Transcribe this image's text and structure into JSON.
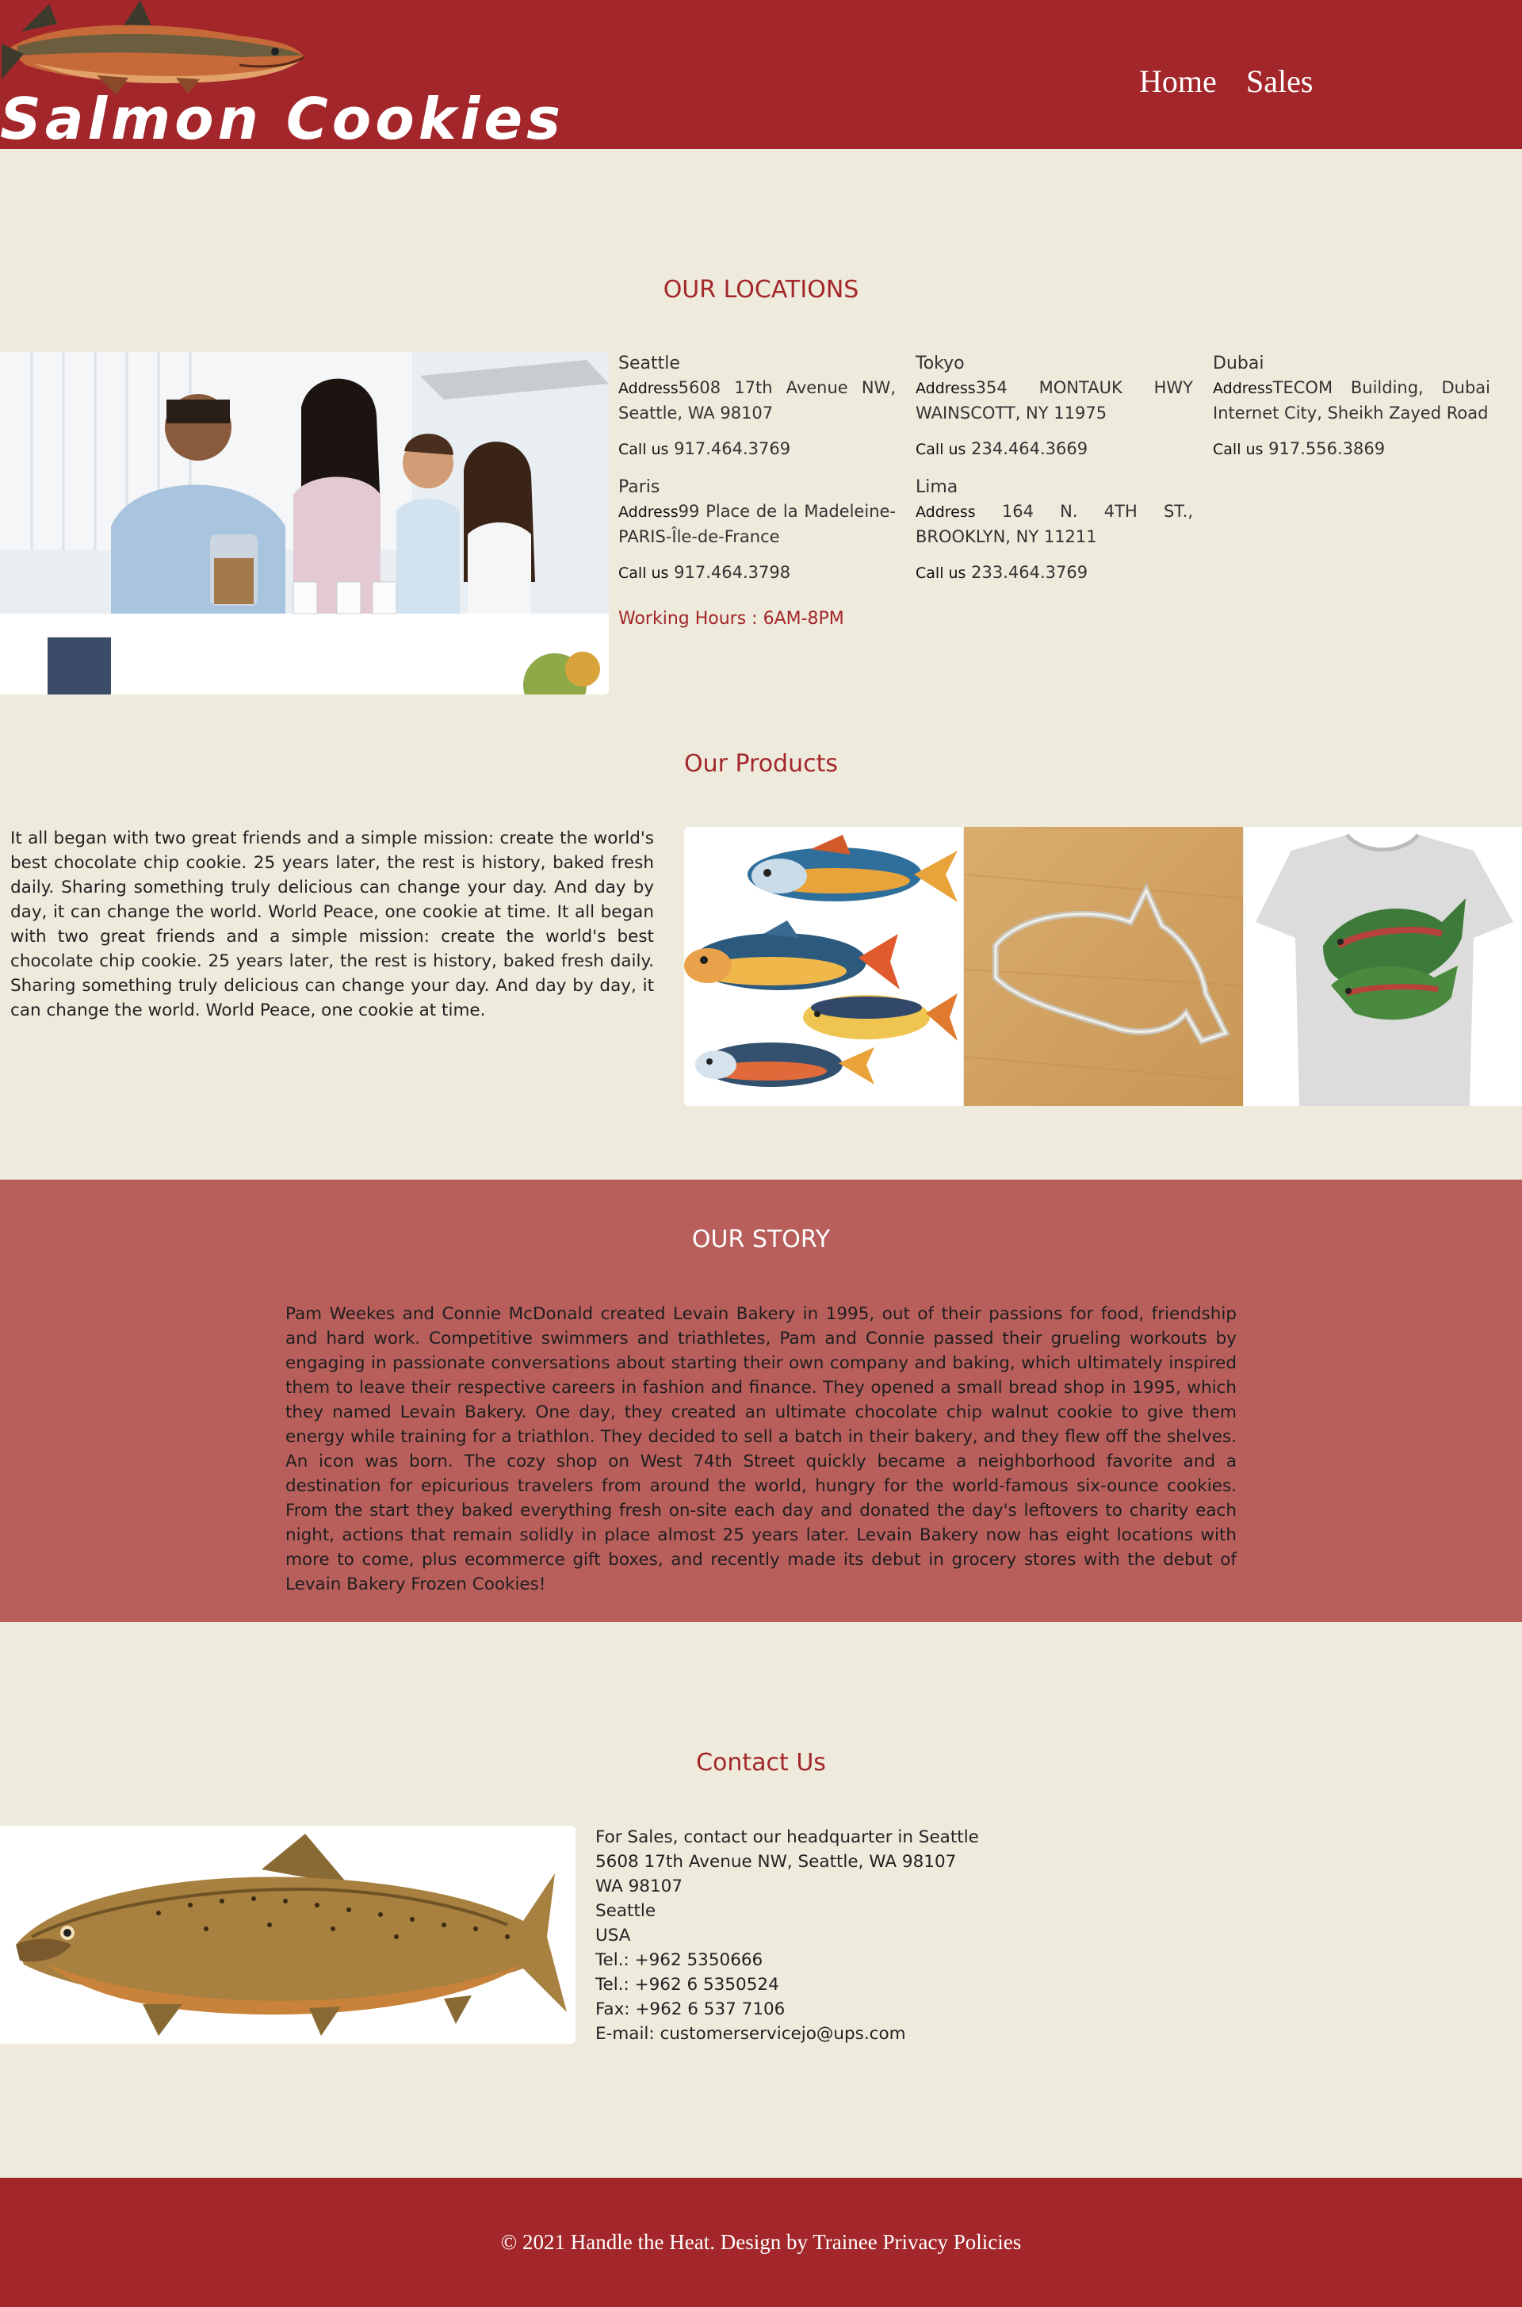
{
  "header": {
    "brand": "Salmon Cookies",
    "nav": [
      "Home",
      "Sales"
    ],
    "logo_icon": "salmon-fish-logo"
  },
  "locations": {
    "title": "OUR LOCATIONS",
    "address_label": "Address",
    "call_label": "Call us",
    "items": [
      {
        "city": "Seattle",
        "address": "5608 17th Avenue NW, Seattle, WA 98107",
        "phone": "917.464.3769"
      },
      {
        "city": "Tokyo",
        "address": "354 MONTAUK HWY WAINSCOTT, NY 11975",
        "phone": "234.464.3669"
      },
      {
        "city": "Dubai",
        "address": "TECOM Building, Dubai Internet City, Sheikh Zayed Road",
        "phone": "917.556.3869"
      },
      {
        "city": "Paris",
        "address": "99 Place de la Madeleine-PARIS-Île-de-France",
        "phone": "917.464.3798"
      },
      {
        "city": "Lima",
        "address": " 164 N. 4TH ST., BROOKLYN, NY 11211",
        "phone": "233.464.3769"
      }
    ],
    "hours": "Working Hours : 6AM-8PM"
  },
  "products": {
    "title": "Our Products",
    "text": "It all began with two great friends and a simple mission: create the world's best chocolate chip cookie. 25 years later, the rest is history, baked fresh daily. Sharing something truly delicious can change your day. And day by day, it can change the world. World Peace, one cookie at time. It all began with two great friends and a simple mission: create the world's best chocolate chip cookie. 25 years later, the rest is history, baked fresh daily. Sharing something truly delicious can change your day. And day by day, it can change the world. World Peace, one cookie at time."
  },
  "story": {
    "title": "OUR STORY",
    "text": "Pam Weekes and Connie McDonald created Levain Bakery in 1995, out of their passions for food, friendship and hard work. Competitive swimmers and triathletes, Pam and Connie passed their grueling workouts by engaging in passionate conversations about starting their own company and baking, which ultimately inspired them to leave their respective careers in fashion and finance. They opened a small bread shop in 1995, which they named Levain Bakery. One day, they created an ultimate chocolate chip walnut cookie to give them energy while training for a triathlon. They decided to sell a batch in their bakery, and they flew off the shelves. An icon was born. The cozy shop on West 74th Street quickly became a neighborhood favorite and a destination for epicurious travelers from around the world, hungry for the world-famous six-ounce cookies. From the start they baked everything fresh on-site each day and donated the day's leftovers to charity each night, actions that remain solidly in place almost 25 years later. Levain Bakery now has eight locations with more to come, plus ecommerce gift boxes, and recently made its debut in grocery stores with the debut of Levain Bakery Frozen Cookies!"
  },
  "contact": {
    "title": "Contact Us",
    "lines": [
      "For Sales, contact our headquarter in Seattle",
      "5608 17th Avenue NW, Seattle, WA 98107",
      "WA 98107",
      "Seattle",
      "USA",
      "Tel.: +962 5350666",
      "Tel.: +962 6 5350524",
      "Fax: +962 6 537 7106",
      "E-mail: customerservicejo@ups.com"
    ]
  },
  "footer": {
    "text": "© 2021 Handle the Heat. Design by Trainee Privacy Policies"
  },
  "colors": {
    "brand_red": "#a3272a",
    "story_band": "#b85f5c",
    "page_bg": "#eeeadc"
  }
}
